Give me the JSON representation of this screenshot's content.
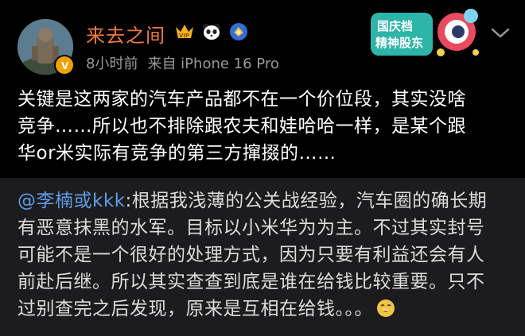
{
  "user": {
    "name": "来去之间",
    "badges": [
      "vip-icon",
      "panda-icon",
      "shield-badge-icon"
    ]
  },
  "meta": {
    "time": "8小时前",
    "source": "来自 iPhone 16 Pro"
  },
  "sticker": {
    "line1": "国庆档",
    "line2": "精神股东"
  },
  "post": {
    "lines": [
      "关键是这两家的汽车产品都不在一个价位段，其实没啥",
      "竞争……所以也不排除跟农夫和娃哈哈一样，是某个跟",
      "华or米实际有竞争的第三方撺掇的……"
    ]
  },
  "quoted": {
    "mention": "@李楠或kkk",
    "line1_rest": ":根据我浅薄的公关战经验，汽车圈的确长期",
    "lines": [
      "有恶意抹黑的水军。目标以小米华为为主。不过其实封号",
      "可能不是一个很好的处理方式，因为只要有利益还会有人",
      "前赴后继。所以其实查查到底是谁在给钱比较重要。只不"
    ],
    "last_line": "过别查完之后发现，原来是互相在给钱。。。",
    "emoji": "sweat-smile-emoji"
  },
  "colors": {
    "username": "#f07b3c",
    "mention": "#5f9ce6",
    "background": "#000000",
    "quoted_background": "#1c1c1e"
  }
}
